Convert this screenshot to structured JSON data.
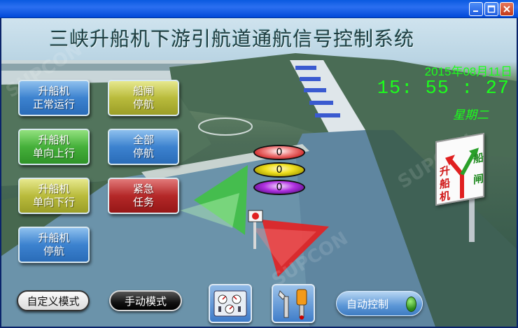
{
  "window": {
    "buttons": [
      "minimize-icon",
      "maximize-icon",
      "close-icon"
    ]
  },
  "app_title": "三峡升船机下游引航道通航信号控制系统",
  "datetime": {
    "date": "2015年08月11日",
    "time": "15: 55 : 27",
    "weekday": "星期二"
  },
  "controls": {
    "lift_normal": {
      "line1": "升船机",
      "line2": "正常运行"
    },
    "lock_stop": {
      "line1": "船闸",
      "line2": "停航"
    },
    "lift_up": {
      "line1": "升船机",
      "line2": "单向上行"
    },
    "all_stop": {
      "line1": "全部",
      "line2": "停航"
    },
    "lift_down": {
      "line1": "升船机",
      "line2": "单向下行"
    },
    "emergency": {
      "line1": "紧急",
      "line2": "任务"
    },
    "lift_stop": {
      "line1": "升船机",
      "line2": "停航"
    }
  },
  "signals": {
    "red": "0",
    "yellow": "0",
    "purple": "0"
  },
  "sign_board": {
    "left": [
      "升",
      "船",
      "机"
    ],
    "right": [
      "船",
      "闸"
    ]
  },
  "bottom": {
    "custom_mode": "自定义模式",
    "manual_mode": "手动模式",
    "auto_control": "自动控制"
  },
  "colors": {
    "clock": "#1cff1c",
    "signal_red": "#e03030",
    "signal_yellow": "#f0e020",
    "signal_purple": "#b030e0",
    "arrow_green": "#3ec43e",
    "arrow_red": "#e62020"
  }
}
